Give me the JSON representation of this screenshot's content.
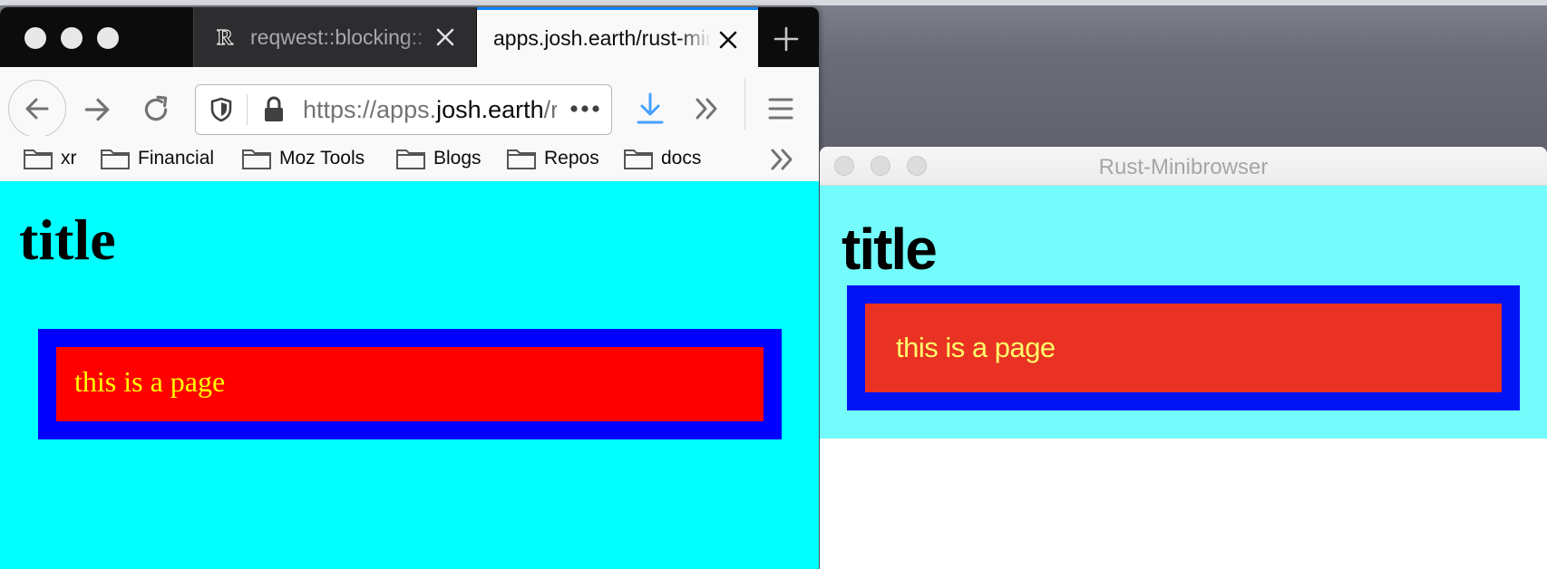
{
  "firefox": {
    "tabs": [
      {
        "label": "reqwest::blocking::",
        "active": false
      },
      {
        "label": "apps.josh.earth/rust-mini",
        "active": true
      }
    ],
    "url": {
      "prefix": "https://apps.",
      "domain": "josh.earth",
      "suffix": "/rust-minibrowser"
    },
    "bookmarks": [
      "xr",
      "Financial",
      "Moz Tools",
      "Blogs",
      "Repos",
      "docs"
    ],
    "page": {
      "heading": "title",
      "paragraph": "this is a page"
    },
    "colors": {
      "background": "#00ffff",
      "outer_box": "#0000ff",
      "inner_box": "#ff0000",
      "text": "#ffff00"
    }
  },
  "minibrowser": {
    "window_title": "Rust-Minibrowser",
    "page": {
      "heading": "title",
      "paragraph": "this is a page"
    },
    "colors": {
      "background": "#73fcfb",
      "outer_box": "#0014f5",
      "inner_box": "#e93223",
      "text": "#fdfc6b"
    }
  },
  "icons": [
    "back-icon",
    "forward-icon",
    "reload-icon",
    "shield-icon",
    "lock-icon",
    "page-actions-icon",
    "download-icon",
    "overflow-icon",
    "menu-icon",
    "folder-icon",
    "close-icon",
    "new-tab-icon",
    "rust-favicon"
  ]
}
